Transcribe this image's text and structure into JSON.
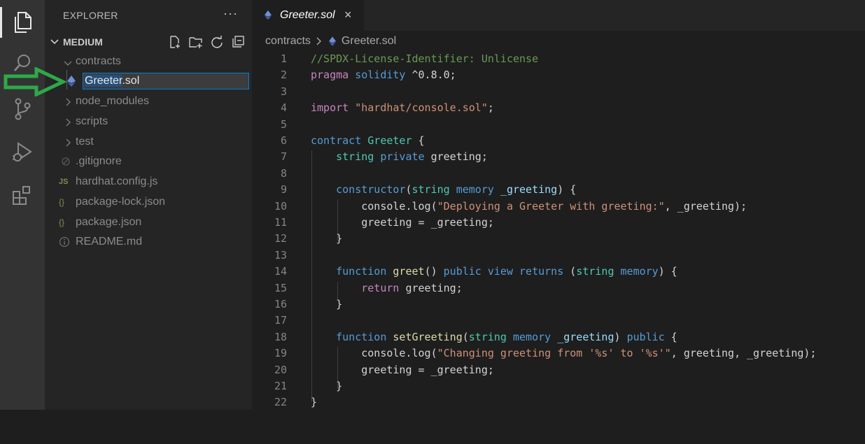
{
  "activity_bar": {
    "items": [
      {
        "icon": "files-icon",
        "active": true
      },
      {
        "icon": "search-icon",
        "active": false
      },
      {
        "icon": "source-control-icon",
        "active": false
      },
      {
        "icon": "run-debug-icon",
        "active": false
      },
      {
        "icon": "extensions-icon",
        "active": false
      }
    ]
  },
  "sidebar": {
    "header": "EXPLORER",
    "more": "···",
    "section_title": "MEDIUM",
    "tree": [
      {
        "label": "contracts",
        "type": "folder-open"
      },
      {
        "label": "node_modules",
        "type": "folder"
      },
      {
        "label": "scripts",
        "type": "folder"
      },
      {
        "label": "test",
        "type": "folder"
      },
      {
        "label": ".gitignore",
        "type": "file"
      },
      {
        "label": "hardhat.config.js",
        "type": "js",
        "badge": "JS"
      },
      {
        "label": "package-lock.json",
        "type": "json",
        "badge": "{}"
      },
      {
        "label": "package.json",
        "type": "json",
        "badge": "{}"
      },
      {
        "label": "README.md",
        "type": "info"
      }
    ],
    "rename": {
      "selected": "Greeter",
      "rest": ".sol"
    }
  },
  "editor": {
    "tab_title": "Greeter.sol",
    "tab_close": "×",
    "breadcrumb": [
      "contracts",
      "Greeter.sol"
    ],
    "line_numbers": [
      "1",
      "2",
      "3",
      "4",
      "5",
      "6",
      "7",
      "8",
      "9",
      "10",
      "11",
      "12",
      "13",
      "14",
      "15",
      "16",
      "17",
      "18",
      "19",
      "20",
      "21",
      "22"
    ],
    "code": {
      "l1": "//SPDX-License-Identifier: Unlicense",
      "l2a": "pragma",
      "l2b": "solidity",
      "l2c": "^0.8.0;",
      "l4a": "import",
      "l4b": "\"hardhat/console.sol\"",
      "l4c": ";",
      "l6a": "contract",
      "l6b": "Greeter",
      "l6c": "{",
      "l7a": "string",
      "l7b": "private",
      "l7c": "greeting;",
      "l9a": "constructor",
      "l9b": "(",
      "l9c": "string",
      "l9d": "memory",
      "l9e": "_greeting",
      "l9f": ") {",
      "l10a": "console",
      "l10b": ".",
      "l10c": "log",
      "l10d": "(",
      "l10e": "\"Deploying a Greeter with greeting:\"",
      "l10f": ", _greeting);",
      "l11": "greeting = _greeting;",
      "l12": "}",
      "l14a": "function",
      "l14b": "greet",
      "l14c": "() ",
      "l14d": "public",
      "l14e": "view",
      "l14f": "returns",
      "l14g": " (",
      "l14h": "string",
      "l14i": "memory",
      "l14j": ") {",
      "l15a": "return",
      "l15b": "greeting;",
      "l16": "}",
      "l18a": "function",
      "l18b": "setGreeting",
      "l18c": "(",
      "l18d": "string",
      "l18e": "memory",
      "l18f": "_greeting",
      "l18g": ") ",
      "l18h": "public",
      "l18i": " {",
      "l19a": "console",
      "l19b": ".",
      "l19c": "log",
      "l19d": "(",
      "l19e": "\"Changing greeting from '%s' to '%s'\"",
      "l19f": ", greeting, _greeting);",
      "l20": "greeting = _greeting;",
      "l21": "}",
      "l22": "}"
    }
  },
  "colors": {
    "activity_bg": "#333333",
    "sidebar_bg": "#252526",
    "editor_bg": "#1e1e1e",
    "annotation_arrow": "#2ea84a",
    "focus_border": "#007fd4"
  }
}
